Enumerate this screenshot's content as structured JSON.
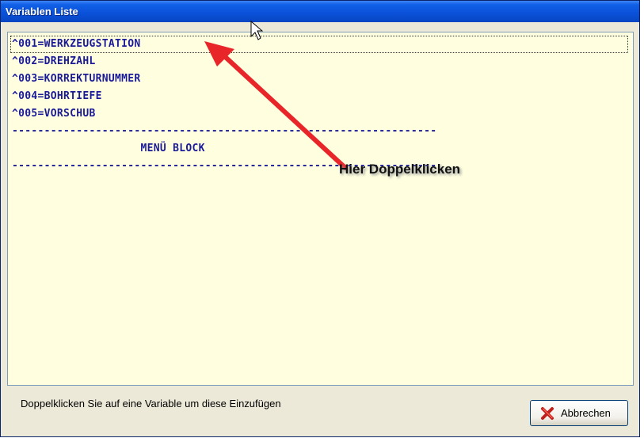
{
  "window": {
    "title": "Variablen Liste"
  },
  "list": {
    "items": [
      "^001=WERKZEUGSTATION",
      "^002=DREHZAHL",
      "^003=KORREKTURNUMMER",
      "^004=BOHRTIEFE",
      "^005=VORSCHUB",
      "------------------------------------------------------------------",
      "                    MENÜ BLOCK",
      "------------------------------------------------------------------"
    ],
    "selected_index": 0,
    "background": "#ffffe0",
    "text_color": "#1a1a99"
  },
  "annotation": {
    "label": "Hier Doppelklicken",
    "arrow_color": "#e8262a"
  },
  "status": {
    "text": "Doppelklicken Sie auf eine Variable um diese Einzufügen"
  },
  "buttons": {
    "cancel_label": "Abbrechen",
    "cancel_icon": "red-x-icon"
  },
  "colors": {
    "titlebar": "#0a50d8",
    "dialog_bg": "#ece9d8"
  }
}
